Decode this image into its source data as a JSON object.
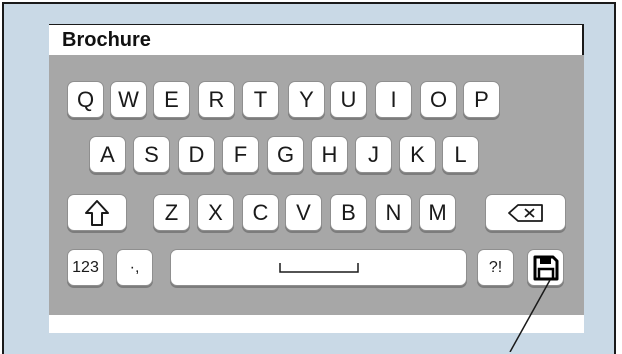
{
  "document": {
    "title": "Brochure"
  },
  "keyboard": {
    "row1": [
      "Q",
      "W",
      "E",
      "R",
      "T",
      "Y",
      "U",
      "I",
      "O",
      "P"
    ],
    "row2": [
      "A",
      "S",
      "D",
      "F",
      "G",
      "H",
      "J",
      "K",
      "L"
    ],
    "row3": [
      "Z",
      "X",
      "C",
      "V",
      "B",
      "N",
      "M"
    ],
    "numbers_label": "123",
    "punct_label": "·,",
    "symbols_label": "?!"
  },
  "icons": {
    "shift": "shift-arrow-icon",
    "backspace": "backspace-icon",
    "space": "space-bar-icon",
    "save": "floppy-disk-save-icon"
  }
}
